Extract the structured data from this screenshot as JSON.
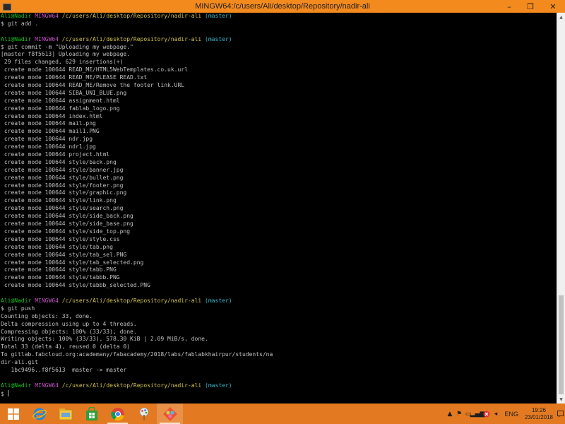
{
  "window": {
    "title": "MINGW64:/c/users/Ali/desktop/Repository/nadir-ali",
    "minimize_glyph": "–",
    "restore_glyph": "❐",
    "close_glyph": "✕"
  },
  "prompt": {
    "user": "Ali@Nadir",
    "env": "MINGW64",
    "path": "/c/users/Ali/desktop/Repository/nadir-ali",
    "branch": "(master)",
    "symbol": "$"
  },
  "colors": {
    "titlebar": "#f28a1e",
    "taskbar": "#e37a22",
    "prompt_user": "#19c419",
    "prompt_env": "#c050c0",
    "prompt_path": "#d4c44c",
    "prompt_branch": "#3ab6c8",
    "text": "#c0c0c0"
  },
  "commands": {
    "add": "git add .",
    "commit": "git commit -m \"Uploading my webpage.\"",
    "push": "git push"
  },
  "commit_output": [
    "[master f8f5613] Uploading my webpage.",
    " 29 files changed, 629 insertions(+)",
    " create mode 100644 READ_ME/HTML5WebTemplates.co.uk.url",
    " create mode 100644 READ_ME/PLEASE READ.txt",
    " create mode 100644 READ_ME/Remove the footer link.URL",
    " create mode 100644 SIBA_UNI_BLUE.png",
    " create mode 100644 assignment.html",
    " create mode 100644 fablab_logo.png",
    " create mode 100644 index.html",
    " create mode 100644 mail.png",
    " create mode 100644 mail1.PNG",
    " create mode 100644 ndr.jpg",
    " create mode 100644 ndr1.jpg",
    " create mode 100644 project.html",
    " create mode 100644 style/back.png",
    " create mode 100644 style/banner.jpg",
    " create mode 100644 style/bullet.png",
    " create mode 100644 style/footer.png",
    " create mode 100644 style/graphic.png",
    " create mode 100644 style/link.png",
    " create mode 100644 style/search.png",
    " create mode 100644 style/side_back.png",
    " create mode 100644 style/side_base.png",
    " create mode 100644 style/side_top.png",
    " create mode 100644 style/style.css",
    " create mode 100644 style/tab.png",
    " create mode 100644 style/tab_sel.PNG",
    " create mode 100644 style/tab_selected.png",
    " create mode 100644 style/tabb.PNG",
    " create mode 100644 style/tabbb.PNG",
    " create mode 100644 style/tabbb_selected.PNG"
  ],
  "push_output": [
    "Counting objects: 33, done.",
    "Delta compression using up to 4 threads.",
    "Compressing objects: 100% (33/33), done.",
    "Writing objects: 100% (33/33), 578.30 KiB | 2.09 MiB/s, done.",
    "Total 33 (delta 4), reused 0 (delta 0)",
    "To gitlab.fabcloud.org:academany/fabacademy/2018/labs/fablabkhairpur/students/na",
    "dir-ali.git",
    "   1bc9496..f8f5613  master -> master"
  ],
  "taskbar": {
    "language": "ENG",
    "time": "19:26",
    "date": "23/01/2018",
    "tray_up_glyph": "▲",
    "tray_flag_glyph": "⚑",
    "tray_monitor_glyph": "▭",
    "tray_signal_glyph": "▂▄▆",
    "tray_volume_glyph": "◂"
  }
}
